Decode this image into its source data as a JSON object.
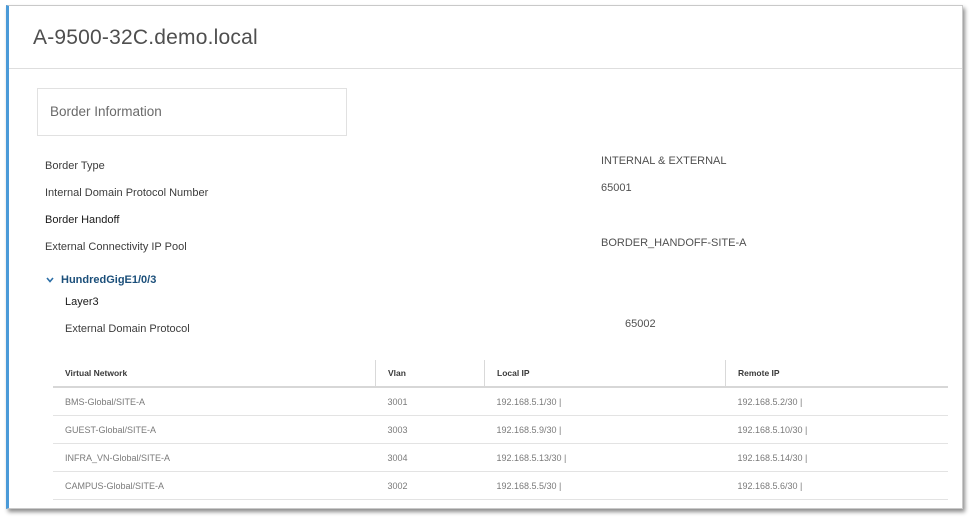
{
  "device": {
    "title": "A-9500-32C.demo.local"
  },
  "section": {
    "title": "Border Information"
  },
  "border": {
    "type_label": "Border Type",
    "type_value": "INTERNAL & EXTERNAL",
    "internal_protocol_label": "Internal Domain Protocol Number",
    "internal_protocol_value": "65001",
    "handoff_label": "Border Handoff",
    "pool_label": "External Connectivity IP Pool",
    "pool_value": "BORDER_HANDOFF-SITE-A"
  },
  "interface": {
    "name": "HundredGigE1/0/3",
    "layer": "Layer3",
    "external_protocol_label": "External Domain Protocol",
    "external_protocol_value": "65002"
  },
  "table": {
    "headers": [
      "Virtual Network",
      "Vlan",
      "Local IP",
      "Remote IP"
    ],
    "rows": [
      [
        "BMS-Global/SITE-A",
        "3001",
        "192.168.5.1/30 |",
        "192.168.5.2/30 |"
      ],
      [
        "GUEST-Global/SITE-A",
        "3003",
        "192.168.5.9/30 |",
        "192.168.5.10/30 |"
      ],
      [
        "INFRA_VN-Global/SITE-A",
        "3004",
        "192.168.5.13/30 |",
        "192.168.5.14/30 |"
      ],
      [
        "CAMPUS-Global/SITE-A",
        "3002",
        "192.168.5.5/30 |",
        "192.168.5.6/30 |"
      ]
    ]
  },
  "colors": {
    "accent": "#4a9ad8",
    "link": "#1b4f7a"
  }
}
